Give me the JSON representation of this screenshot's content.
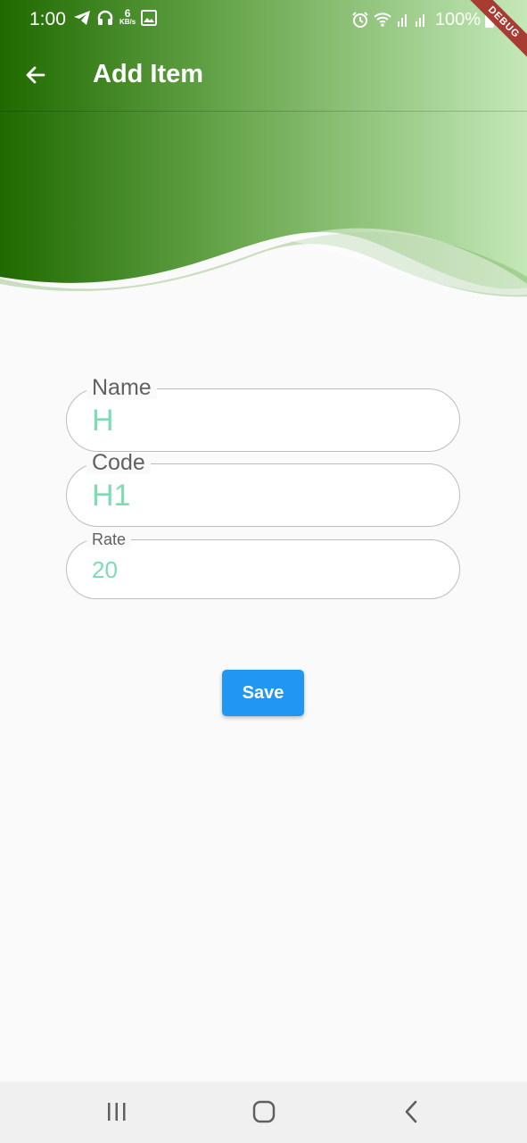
{
  "status_bar": {
    "time": "1:00",
    "network_speed_value": "6",
    "network_speed_unit": "KB/s",
    "battery": "100%",
    "debug_banner": "DEBUG",
    "icons": [
      "telegram-icon",
      "headphones-icon",
      "image-icon",
      "alarm-icon",
      "wifi-icon",
      "signal-icon",
      "battery-icon"
    ]
  },
  "app_bar": {
    "title": "Add Item",
    "back_icon": "arrow-left-icon"
  },
  "form": {
    "name": {
      "label": "Name",
      "value": "H"
    },
    "code": {
      "label": "Code",
      "value": "H1"
    },
    "rate": {
      "label": "Rate",
      "value": "20"
    }
  },
  "actions": {
    "save_label": "Save"
  },
  "nav_bar": {
    "icons": [
      "recent-apps-icon",
      "home-icon",
      "back-icon"
    ]
  },
  "colors": {
    "header_dark": "#1f6a00",
    "header_light": "#c4e8b8",
    "value_text": "#7fdcb0",
    "save_button": "#2196f3",
    "debug_banner": "#a83b32"
  }
}
